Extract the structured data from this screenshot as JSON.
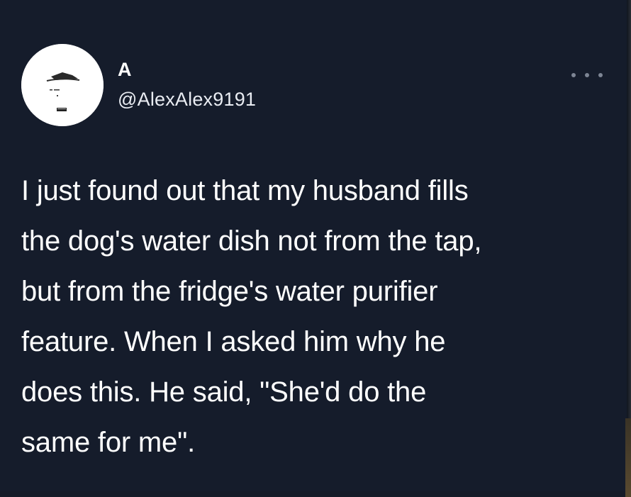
{
  "tweet": {
    "author": {
      "display_name": "A",
      "handle": "@AlexAlex9191",
      "avatar_icon": "car-sketch-logo-icon"
    },
    "menu_icon": "more-options-icon",
    "text": "I just found out that my husband fills\nthe dog's water dish not from the tap,\nbut from the fridge's water purifier\nfeature. When I asked him why he\ndoes this. He said,  \"She'd do the\nsame for me\"."
  },
  "colors": {
    "background": "#151c2b",
    "text": "#ffffff",
    "secondary_text": "#e9ecf2",
    "menu_dots": "#7d8594"
  }
}
